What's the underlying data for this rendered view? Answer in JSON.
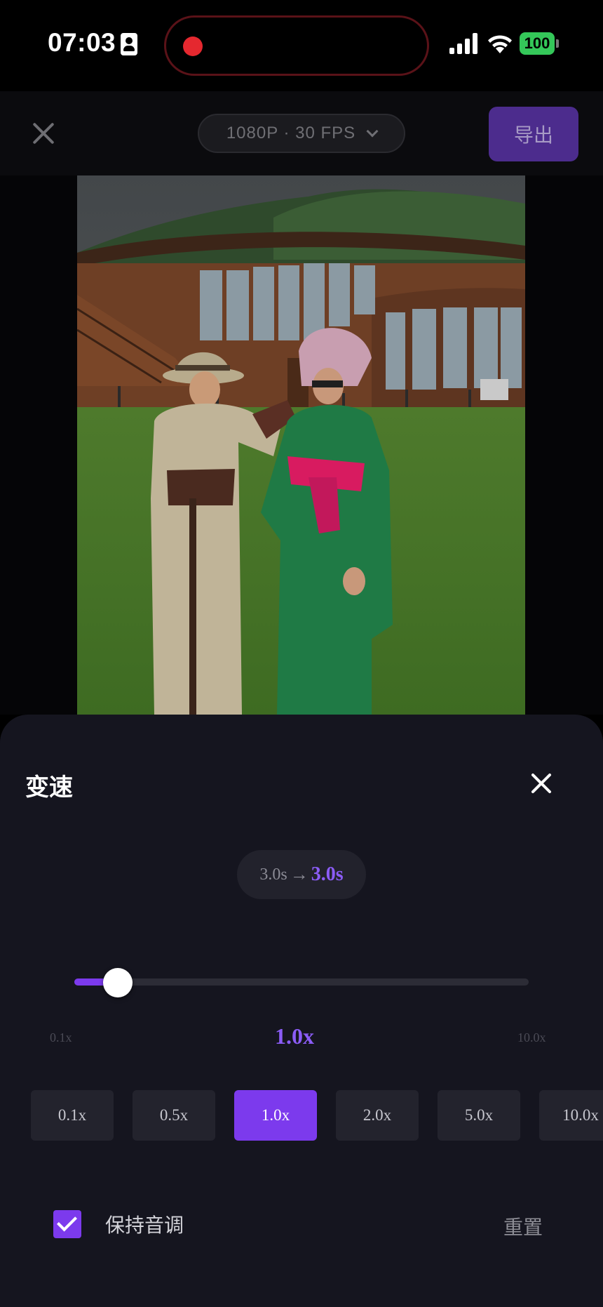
{
  "status_bar": {
    "time": "07:03",
    "battery": "100"
  },
  "toolbar": {
    "resolution": "1080P · 30 FPS",
    "export_label": "导出"
  },
  "colors": {
    "accent": "#7c3aed",
    "accent_text": "#8b5cf6",
    "panel_bg": "#15151f",
    "recording": "#e5282f",
    "battery": "#34c759"
  },
  "speed_panel": {
    "title": "变速",
    "duration_from": "3.0s",
    "duration_arrow": "→",
    "duration_to": "3.0s",
    "slider": {
      "min_label": "0.1x",
      "max_label": "10.0x",
      "current_label": "1.0x",
      "value": 1.0,
      "min": 0.1,
      "max": 10.0
    },
    "presets": [
      "0.1x",
      "0.5x",
      "1.0x",
      "2.0x",
      "5.0x",
      "10.0x"
    ],
    "selected_preset": "1.0x",
    "keep_pitch_label": "保持音调",
    "keep_pitch_checked": true,
    "reset_label": "重置"
  }
}
